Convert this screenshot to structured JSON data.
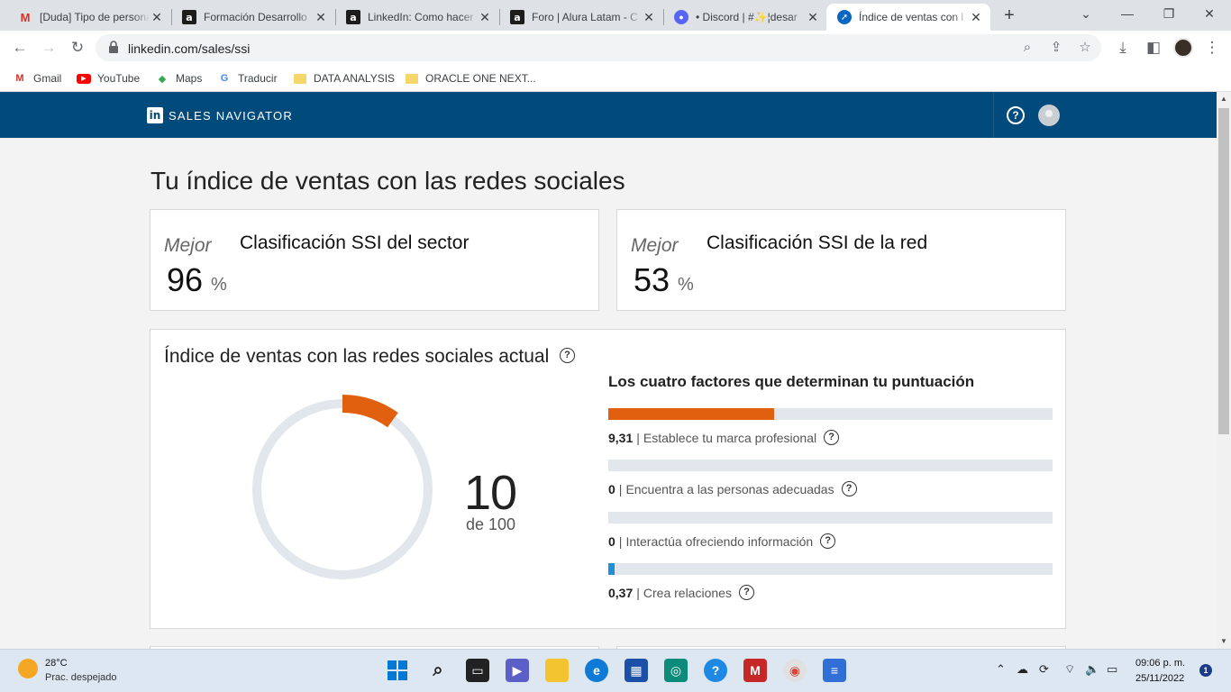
{
  "browser": {
    "tabs": [
      {
        "favicon": "gmail-icon",
        "title": "[Duda] Tipo de persona",
        "close": "✕"
      },
      {
        "favicon": "alura-icon",
        "title": "Formación Desarrollo",
        "close": "✕"
      },
      {
        "favicon": "alura-icon",
        "title": "LinkedIn: Como hacer",
        "close": "✕"
      },
      {
        "favicon": "alura-icon",
        "title": "Foro | Alura Latam - C",
        "close": "✕"
      },
      {
        "favicon": "discord-icon",
        "title": "• Discord | #✨¦desar",
        "close": "✕"
      },
      {
        "favicon": "compass-icon",
        "title": "Índice de ventas con l",
        "close": "✕"
      }
    ],
    "active_tab": 5,
    "new_tab": "+",
    "url": "linkedin.com/sales/ssi",
    "bookmarks": [
      {
        "icon": "gmail-icon",
        "label": "Gmail"
      },
      {
        "icon": "youtube-icon",
        "label": "YouTube"
      },
      {
        "icon": "maps-icon",
        "label": "Maps"
      },
      {
        "icon": "translate-icon",
        "label": "Traducir"
      },
      {
        "icon": "folder-icon",
        "label": "DATA ANALYSIS"
      },
      {
        "icon": "folder-icon",
        "label": "ORACLE ONE NEXT..."
      }
    ]
  },
  "header": {
    "logo": "in",
    "brand": "SALES NAVIGATOR"
  },
  "page": {
    "title": "Tu índice de ventas con las redes sociales",
    "rankings": [
      {
        "label": "Mejor",
        "title": "Clasificación SSI del sector",
        "value": "96",
        "unit": "%"
      },
      {
        "label": "Mejor",
        "title": "Clasificación SSI de la red",
        "value": "53",
        "unit": "%"
      }
    ],
    "ssi": {
      "title": "Índice de ventas con las redes sociales actual",
      "score": "10",
      "score_total": "de 100",
      "score_value": 10,
      "score_max": 100,
      "factors_title": "Los cuatro factores que determinan tu puntuación",
      "factors": [
        {
          "value": "9,31",
          "label": "Establece tu marca profesional",
          "fraction": 0.3724,
          "color": "#e06010"
        },
        {
          "value": "0",
          "label": "Encuentra a las personas adecuadas",
          "fraction": 0,
          "color": "#f2a623"
        },
        {
          "value": "0",
          "label": "Interactúa ofreciendo información",
          "fraction": 0,
          "color": "#6c3a9c"
        },
        {
          "value": "0,37",
          "label": "Crea relaciones",
          "fraction": 0.0148,
          "color": "#1f8fd6"
        }
      ]
    }
  },
  "taskbar": {
    "weather_temp": "28°C",
    "weather_desc": "Prac. despejado",
    "time": "09:06 p. m.",
    "date": "25/11/2022",
    "notifications": "1"
  },
  "colors": {
    "linkedin_header": "#004b7c",
    "donut_track": "#e1e7ec",
    "donut_fill": "#e06010"
  }
}
